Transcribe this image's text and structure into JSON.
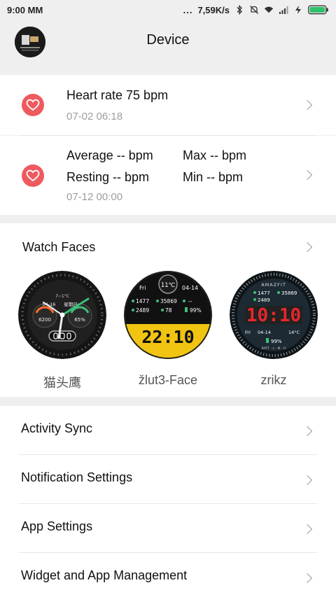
{
  "status_bar": {
    "time": "9:00 MM",
    "dots": "...",
    "network_speed": "7,59K/s"
  },
  "header": {
    "title": "Device"
  },
  "heart_rate": {
    "title": "Heart rate 75 bpm",
    "timestamp": "07-02 06:18"
  },
  "heart_stats": {
    "average": "Average -- bpm",
    "max": "Max -- bpm",
    "resting": "Resting -- bpm",
    "min": "Min -- bpm",
    "timestamp": "07-12 00:00"
  },
  "watch_faces": {
    "title": "Watch Faces",
    "items": [
      {
        "name": "猫头鹰",
        "weather": "7~1°C",
        "date": "04-16",
        "weekday": "星期日",
        "left_value": "6200",
        "right_value": "65%"
      },
      {
        "name": "žlut3-Face",
        "day": "Fri",
        "date": "04-14",
        "temp": "11℃",
        "steps": "1477",
        "value2": "35869",
        "value3": "--",
        "calories": "2489",
        "heart": "78",
        "battery": "99%",
        "time": "22:10"
      },
      {
        "name": "zrikz",
        "brand": "AMAZFIT",
        "steps": "1477",
        "value2": "35869",
        "calories": "2489",
        "time": "10:10",
        "day": "Fri",
        "date": "04-14",
        "temp": "14°C",
        "battery": "99%",
        "batt_scale": "BATT - L - M - H"
      }
    ]
  },
  "menu": {
    "items": [
      {
        "label": "Activity Sync"
      },
      {
        "label": "Notification Settings"
      },
      {
        "label": "App Settings"
      },
      {
        "label": "Widget and App Management"
      }
    ]
  }
}
